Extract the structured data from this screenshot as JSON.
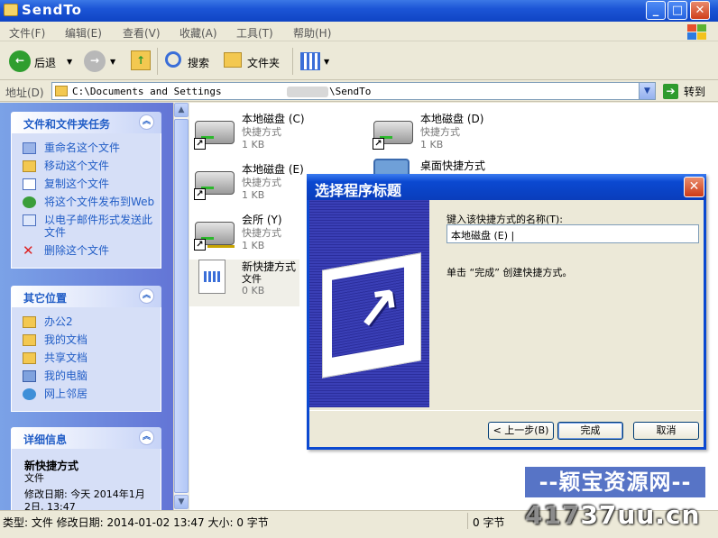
{
  "window": {
    "title": "SendTo"
  },
  "menu": [
    "文件(F)",
    "编辑(E)",
    "查看(V)",
    "收藏(A)",
    "工具(T)",
    "帮助(H)"
  ],
  "toolbar": {
    "back": "后退",
    "search": "搜索",
    "folders": "文件夹"
  },
  "address": {
    "label": "地址(D)",
    "path_before": "C:\\Documents and Settings",
    "path_after": "\\SendTo",
    "go": "转到"
  },
  "tasks": {
    "title": "文件和文件夹任务",
    "items": [
      "重命名这个文件",
      "移动这个文件",
      "复制这个文件",
      "将这个文件发布到Web",
      "以电子邮件形式发送此文件",
      "删除这个文件"
    ]
  },
  "other_places": {
    "title": "其它位置",
    "items": [
      "办公2",
      "我的文档",
      "共享文档",
      "我的电脑",
      "网上邻居"
    ]
  },
  "details": {
    "title": "详细信息",
    "name": "新快捷方式",
    "type": "文件",
    "modified": "修改日期: 今天 2014年1月2日, 13:47"
  },
  "files": [
    {
      "name": "本地磁盘 (C)",
      "type": "快捷方式",
      "size": "1 KB"
    },
    {
      "name": "本地磁盘 (D)",
      "type": "快捷方式",
      "size": "1 KB"
    },
    {
      "name": "本地磁盘 (E)",
      "type": "快捷方式",
      "size": "1 KB"
    },
    {
      "name": "桌面快捷方式",
      "type": "",
      "size": ""
    },
    {
      "name": "会所 (Y)",
      "type": "快捷方式",
      "size": "1 KB"
    },
    {
      "name": "新快捷方式",
      "type": "文件",
      "size": "0 KB"
    }
  ],
  "dialog": {
    "title": "选择程序标题",
    "name_label": "键入该快捷方式的名称(T):",
    "name_value": "本地磁盘 (E) |",
    "hint": "单击 “完成” 创建快捷方式。",
    "back": "< 上一步(B)",
    "finish": "完成",
    "cancel": "取消"
  },
  "status": {
    "left": "类型: 文件 修改日期: 2014-01-02 13:47 大小: 0 字节",
    "right": "0 字节"
  },
  "watermark": {
    "line1": "--颖宝资源网--",
    "line2a": "417",
    "line2b": "37uu.cn"
  }
}
